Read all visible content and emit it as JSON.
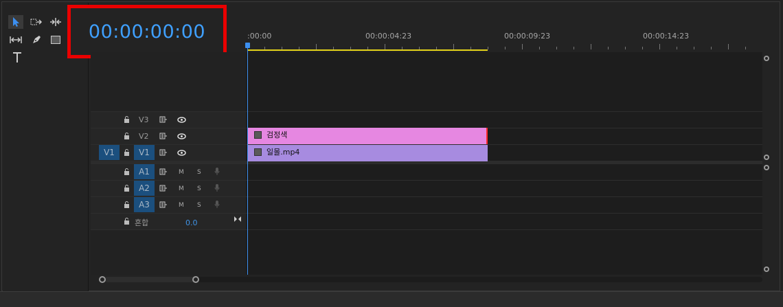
{
  "timecode": "00:00:00:00",
  "ruler": {
    "labels": [
      ":00:00",
      "00:00:04:23",
      "00:00:09:23",
      "00:00:14:23"
    ]
  },
  "tracks": {
    "video": [
      {
        "name": "V3",
        "source_target": "",
        "track_target": "V3"
      },
      {
        "name": "V2",
        "source_target": "",
        "track_target": "V2"
      },
      {
        "name": "V1",
        "source_target": "V1",
        "track_target": "V1"
      }
    ],
    "audio": [
      {
        "name": "A1",
        "mute": "M",
        "solo": "S"
      },
      {
        "name": "A2",
        "mute": "M",
        "solo": "S"
      },
      {
        "name": "A3",
        "mute": "M",
        "solo": "S"
      }
    ],
    "mix": {
      "label": "혼합",
      "value": "0.0"
    }
  },
  "clips": {
    "v2": {
      "name": "검정색",
      "color": "#e687e1"
    },
    "v1": {
      "name": "일몰.mp4",
      "color": "#a78be0"
    }
  },
  "colors": {
    "timecode": "#3fa0ff",
    "highlight_box": "#ea0000",
    "playhead": "#3c8ff0",
    "work_area": "#e3d21a",
    "target_active": "#1b4f7e"
  },
  "icons": {
    "tools": [
      "selection-tool-icon",
      "track-select-forward-icon",
      "ripple-edit-icon",
      "slip-tool-icon",
      "pen-tool-icon",
      "rectangle-tool-icon",
      "type-tool-icon"
    ],
    "track": [
      "lock-icon",
      "sync-lock-icon",
      "eye-icon",
      "mic-icon"
    ]
  }
}
